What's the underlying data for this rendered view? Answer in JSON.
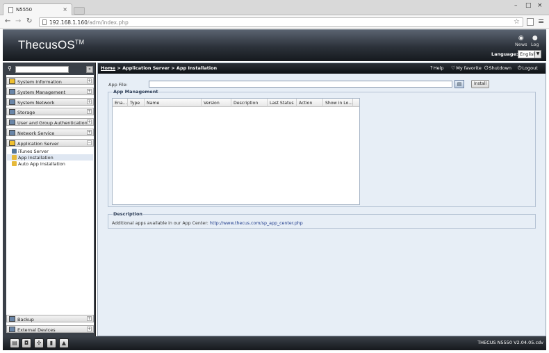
{
  "browser": {
    "tab_title": "N5550",
    "url_host": "192.168.1.160",
    "url_path": "/adm/index.php"
  },
  "header": {
    "logo": "ThecusOS",
    "logo_tm": "TM",
    "news_label": "News",
    "log_label": "Log",
    "language_label": "Language:",
    "language_value": "English"
  },
  "sidebar": {
    "sections_top": [
      {
        "label": "System Information",
        "icon": "info-icon"
      },
      {
        "label": "System Management",
        "icon": "tools-icon"
      },
      {
        "label": "System Network",
        "icon": "network-icon"
      },
      {
        "label": "Storage",
        "icon": "storage-icon"
      },
      {
        "label": "User and Group Authentication",
        "icon": "users-icon"
      },
      {
        "label": "Network Service",
        "icon": "network-service-icon"
      },
      {
        "label": "Application Server",
        "icon": "app-server-icon"
      }
    ],
    "app_items": [
      {
        "label": "iTunes Server"
      },
      {
        "label": "App Installation"
      },
      {
        "label": "Auto App Installation"
      }
    ],
    "sections_bottom": [
      {
        "label": "Backup"
      },
      {
        "label": "External Devices"
      }
    ]
  },
  "main": {
    "breadcrumb_home": "Home",
    "breadcrumb_rest": " > Application Server > App Installation",
    "help": "Help",
    "favorite": "My favorite",
    "shutdown": "Shutdown",
    "logout": "Logout",
    "app_file_label": "App File:",
    "install_label": "Install",
    "app_management_legend": "App Management",
    "columns": [
      "Ena...",
      "Type",
      "Name",
      "Version",
      "Description",
      "Last Status",
      "Action",
      "Show in Lo..."
    ],
    "description_legend": "Description",
    "description_text": "Additional apps available in our App Center: ",
    "description_link": "http://www.thecus.com/sp_app_center.php"
  },
  "footer": {
    "version": "THECUS N5550 V2.04.05.cdv"
  }
}
